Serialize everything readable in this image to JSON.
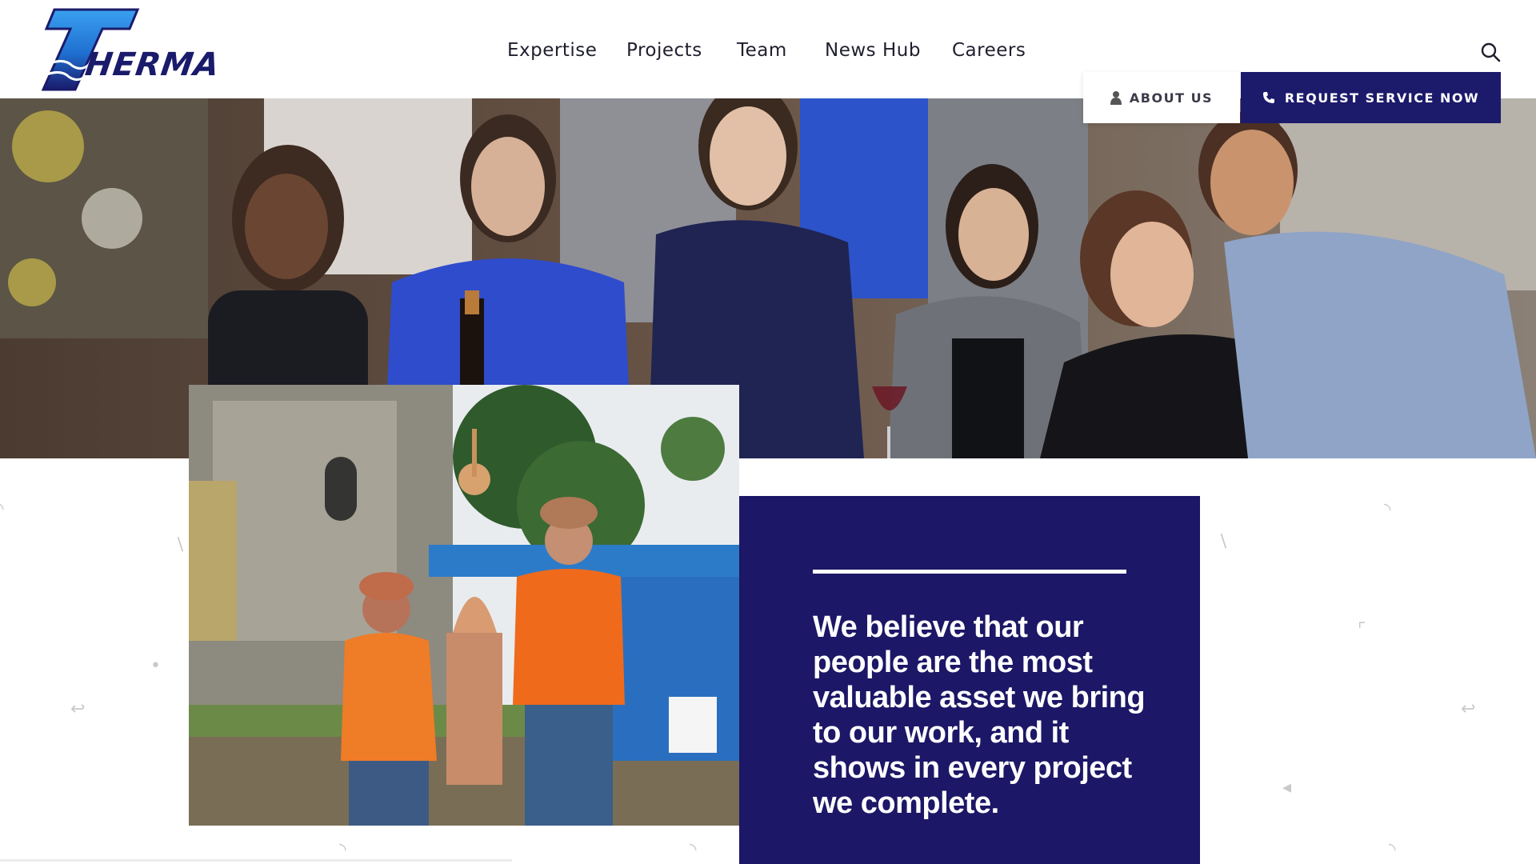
{
  "brand": {
    "logo_text": "HERMA",
    "logo_icon": "therma-t-logo"
  },
  "nav": {
    "items": [
      {
        "label": "Expertise"
      },
      {
        "label": "Projects"
      },
      {
        "label": "Team"
      },
      {
        "label": "News Hub"
      },
      {
        "label": "Careers"
      }
    ]
  },
  "header_actions": {
    "search_icon": "search-icon",
    "about_label": "ABOUT US",
    "about_icon": "user-icon",
    "request_label": "REQUEST SERVICE NOW",
    "request_icon": "phone-icon"
  },
  "quote": {
    "text": "We believe that our people are the most valuable asset we bring to our work, and it shows in every project we complete."
  },
  "colors": {
    "brand_navy": "#1c1a6b",
    "quote_bg": "#1c1766",
    "logo_blue": "#2a6fd6"
  }
}
